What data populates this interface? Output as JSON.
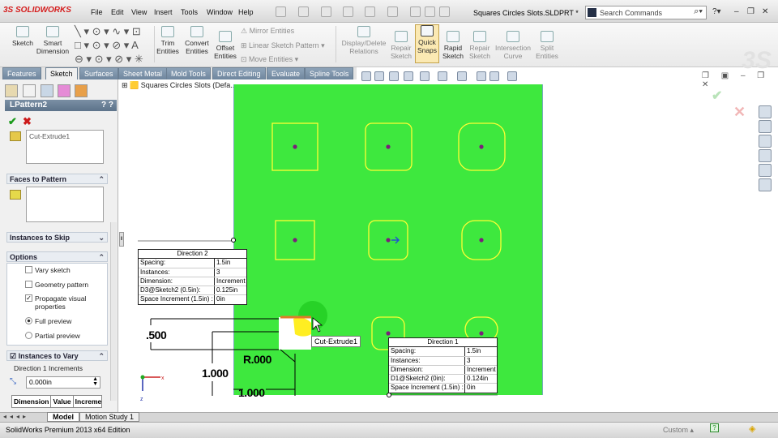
{
  "app": {
    "logo": "SOLIDWORKS",
    "document_title": "Squares Circles Slots.SLDPRT *"
  },
  "menu": [
    "File",
    "Edit",
    "View",
    "Insert",
    "Tools",
    "Window",
    "Help"
  ],
  "search": {
    "placeholder": "Search Commands"
  },
  "ribbon": {
    "sketch": "Sketch",
    "smart_dimension": [
      "Smart",
      "Dimension"
    ],
    "trim": [
      "Trim",
      "Entities"
    ],
    "convert": [
      "Convert",
      "Entities"
    ],
    "offset": [
      "Offset",
      "Entities"
    ],
    "mirror": "Mirror Entities",
    "linear_pattern": "Linear Sketch Pattern",
    "move": "Move Entities",
    "display_delete": [
      "Display/Delete",
      "Relations"
    ],
    "repair1": [
      "Repair",
      "Sketch"
    ],
    "quick_snaps": [
      "Quick",
      "Snaps"
    ],
    "rapid": [
      "Rapid",
      "Sketch"
    ],
    "repair2": [
      "Repair",
      "Sketch"
    ],
    "intersection": [
      "Intersection",
      "Curve"
    ],
    "split": [
      "Split",
      "Entities"
    ]
  },
  "tabs": [
    "Features",
    "Sketch",
    "Surfaces",
    "Sheet Metal",
    "Mold Tools",
    "Direct Editing",
    "Evaluate",
    "Spline Tools"
  ],
  "tree_title": "Squares Circles Slots  (Defa...",
  "property_manager": {
    "title": "LPattern2",
    "list_item": "Cut-Extrude1",
    "groups": {
      "faces": "Faces to Pattern",
      "skip": "Instances to Skip",
      "options": "Options",
      "vary": "Instances to Vary"
    },
    "options": {
      "vary_sketch": "Vary sketch",
      "geometry_pattern": "Geometry pattern",
      "propagate": "Propagate visual properties",
      "full_preview": "Full preview",
      "partial_preview": "Partial preview"
    },
    "dir1_increments": "Direction 1 Increments",
    "increment_value": "0.000in",
    "table_headers": [
      "Dimension",
      "Value",
      "Increme"
    ]
  },
  "direction2": {
    "title": "Direction 2",
    "rows": [
      {
        "k": "Spacing:",
        "v": "1.5in"
      },
      {
        "k": "Instances:",
        "v": "3"
      },
      {
        "k": "Dimension:",
        "v": "Increment"
      },
      {
        "k": "D3@Sketch2 (0.5in):",
        "v": "0.125in"
      },
      {
        "k": "Space Increment (1.5in) :",
        "v": "0in"
      }
    ]
  },
  "direction1": {
    "title": "Direction 1",
    "rows": [
      {
        "k": "Spacing:",
        "v": "1.5in"
      },
      {
        "k": "Instances:",
        "v": "3"
      },
      {
        "k": "Dimension:",
        "v": "Increment"
      },
      {
        "k": "D1@Sketch2 (0in):",
        "v": "0.124in"
      },
      {
        "k": "Space Increment (1.5in) :",
        "v": "0in"
      }
    ]
  },
  "dimensions": {
    "d500": ".500",
    "r000": "R.000",
    "d1000a": "1.000",
    "d1000b": "1.000"
  },
  "tooltip": "Cut-Extrude1",
  "bottom_tabs": [
    "Model",
    "Motion Study 1"
  ],
  "status": {
    "text": "SolidWorks Premium 2013 x64 Edition",
    "custom": "Custom"
  },
  "colors": {
    "green_face": "#3ee83e",
    "sketch_yellow": "#ffff33",
    "point": "#7a1f7a"
  }
}
